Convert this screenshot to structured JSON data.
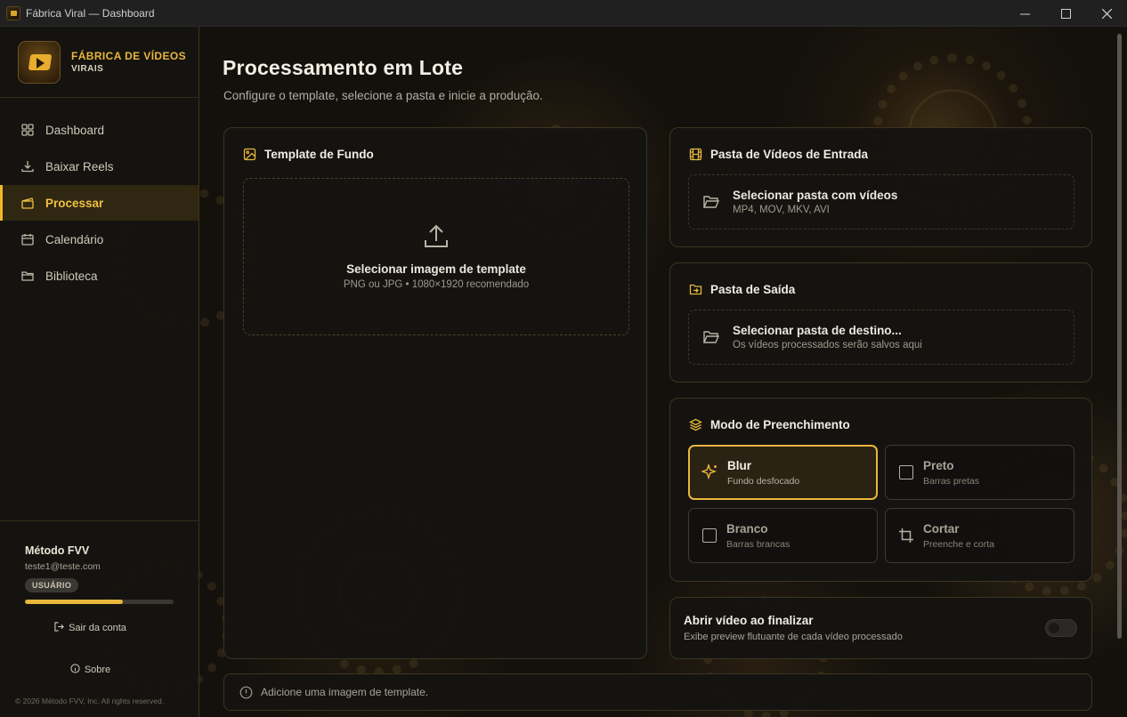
{
  "window": {
    "title": "Fábrica Viral — Dashboard",
    "controls": {
      "minimize": "—",
      "maximize": "☐",
      "close": "✕"
    }
  },
  "brand": {
    "name": "FÁBRICA DE VÍDEOS",
    "sub": "VIRAIS"
  },
  "sidebar": {
    "items": [
      {
        "label": "Dashboard",
        "icon": "grid-icon",
        "active": false
      },
      {
        "label": "Baixar Reels",
        "icon": "download-icon",
        "active": false
      },
      {
        "label": "Processar",
        "icon": "clapperboard-icon",
        "active": true
      },
      {
        "label": "Calendário",
        "icon": "calendar-icon",
        "active": false
      },
      {
        "label": "Biblioteca",
        "icon": "folder-icon",
        "active": false
      }
    ]
  },
  "user": {
    "name": "Método FVV",
    "email": "teste1@teste.com",
    "role": "USUÁRIO",
    "usage_fraction": 0.66,
    "logout_label": "Sair da conta",
    "about_label": "Sobre",
    "copyright": "© 2026 Método FVV, Inc. All rights reserved."
  },
  "main": {
    "title": "Processamento em Lote",
    "subtitle": "Configure o template, selecione a pasta e inicie a produção."
  },
  "template": {
    "title": "Template de Fundo",
    "drop_title": "Selecionar imagem de template",
    "drop_sub": "PNG ou JPG • 1080×1920 recomendado"
  },
  "input_folder": {
    "title": "Pasta de Vídeos de Entrada",
    "pick_title": "Selecionar pasta com vídeos",
    "pick_sub": "MP4, MOV, MKV, AVI"
  },
  "output_folder": {
    "title": "Pasta de Saída",
    "pick_title": "Selecionar pasta de destino...",
    "pick_sub": "Os vídeos processados serão salvos aqui"
  },
  "fill_mode": {
    "title": "Modo de Preenchimento",
    "options": [
      {
        "title": "Blur",
        "sub": "Fundo desfocado",
        "selected": true,
        "icon": "sparkle-icon"
      },
      {
        "title": "Preto",
        "sub": "Barras pretas",
        "selected": false,
        "icon": "square-icon"
      },
      {
        "title": "Branco",
        "sub": "Barras brancas",
        "selected": false,
        "icon": "square-icon"
      },
      {
        "title": "Cortar",
        "sub": "Preenche e corta",
        "selected": false,
        "icon": "crop-icon"
      }
    ]
  },
  "toggle": {
    "title": "Abrir vídeo ao finalizar",
    "sub": "Exibe preview flutuante de cada vídeo processado",
    "on": false
  },
  "status": {
    "text": "Adicione uma imagem de template."
  },
  "colors": {
    "accent": "#e8b73c",
    "background": "#14110c",
    "card": "#141311"
  }
}
